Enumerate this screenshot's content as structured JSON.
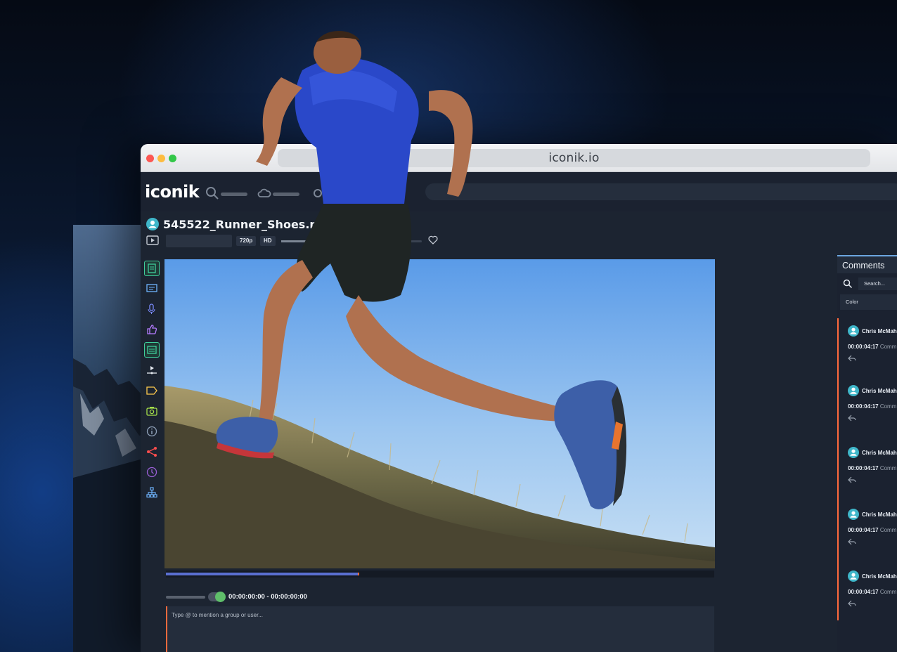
{
  "browser": {
    "url": "iconik.io"
  },
  "app": {
    "logo": "iconik"
  },
  "asset": {
    "title": "545522_Runner_Shoes.mp4",
    "resolution": "720p",
    "quality": "HD"
  },
  "player": {
    "progress": 0.35,
    "timecode": "00:00:00:00 - 00:00:00:00",
    "comment_placeholder": "Type @ to mention a group or user..."
  },
  "tools": [
    "metadata-icon",
    "comments-icon",
    "transcription-icon",
    "approval-icon",
    "subtitles-icon",
    "timeline-icon",
    "tag-icon",
    "camera-icon",
    "info-icon",
    "share-icon",
    "history-icon",
    "hierarchy-icon"
  ],
  "comments": {
    "title": "Comments",
    "search_placeholder": "Search...",
    "filter_label": "Color",
    "items": [
      {
        "author": "Chris McMah",
        "time": "00:00:04:17",
        "text": "Comm"
      },
      {
        "author": "Chris McMah",
        "time": "00:00:04:17",
        "text": "Comm"
      },
      {
        "author": "Chris McMah",
        "time": "00:00:04:17",
        "text": "Comm"
      },
      {
        "author": "Chris McMah",
        "time": "00:00:04:17",
        "text": "Comm"
      },
      {
        "author": "Chris McMah",
        "time": "00:00:04:17",
        "text": "Comm"
      }
    ]
  },
  "colors": {
    "accent_orange": "#ff6a3d",
    "progress_blue": "#5a6fd0",
    "toggle_green": "#5fbf6a",
    "avatar_teal": "#3fb6c9"
  }
}
